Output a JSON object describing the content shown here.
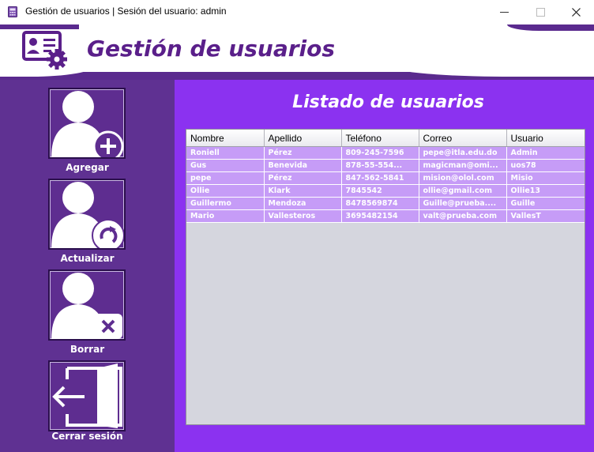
{
  "window": {
    "title": "Gestión de usuarios | Sesión del usuario: admin",
    "minimize_glyph": "—",
    "maximize_glyph": "☐",
    "close_glyph": "✕"
  },
  "header": {
    "title": "Gestión de usuarios",
    "icon": "user-card-settings-icon"
  },
  "sidebar": {
    "add_label": "Agregar",
    "update_label": "Actualizar",
    "delete_label": "Borrar",
    "logout_label": "Cerrar sesión"
  },
  "main": {
    "title": "Listado de usuarios"
  },
  "table": {
    "columns": [
      "Nombre",
      "Apellido",
      "Teléfono",
      "Correo",
      "Usuario"
    ],
    "rows": [
      [
        "Roniell",
        "Pérez",
        "809-245-7596",
        "pepe@itla.edu.do",
        "Admin"
      ],
      [
        "Gus",
        "Benevida",
        "878-55-554...",
        "magicman@omi...",
        "uos78"
      ],
      [
        "pepe",
        "Pérez",
        "847-562-5841",
        "mision@olol.com",
        "Misio"
      ],
      [
        "Ollie",
        "Klark",
        "7845542",
        "ollie@gmail.com",
        "Ollie13"
      ],
      [
        "Guillermo",
        "Mendoza",
        "8478569874",
        "Guille@prueba....",
        "Guille"
      ],
      [
        "Mario",
        "Vallesteros",
        "3695482154",
        "valt@prueba.com",
        "VallesT"
      ]
    ]
  },
  "colors": {
    "sidebar": "#5f3192",
    "main": "#8b32f0",
    "row": "#c69cf7",
    "title": "#5a1f8a"
  }
}
